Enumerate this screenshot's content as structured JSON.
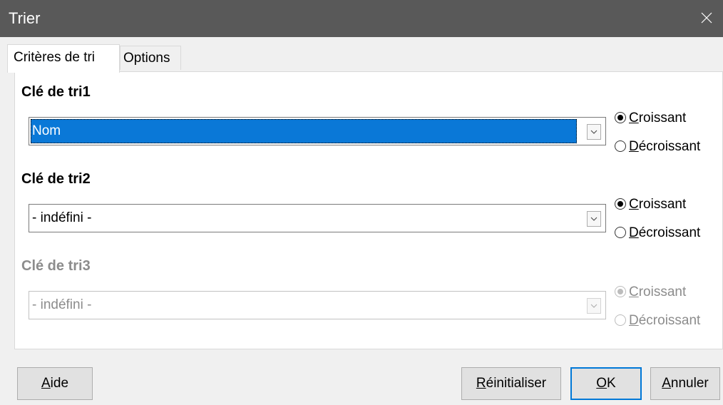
{
  "window": {
    "title": "Trier"
  },
  "tabs": [
    {
      "label": "Critères de tri",
      "active": true
    },
    {
      "label": "Options",
      "active": false
    }
  ],
  "keys": [
    {
      "label": "Clé de tri1",
      "value": "Nom",
      "selected": true,
      "enabled": true,
      "ascending_rest": "roissant",
      "ascending_key": "C",
      "descending_key": "D",
      "descending_rest": "écroissant",
      "order": "ascending"
    },
    {
      "label": "Clé de tri2",
      "value": "- indéfini -",
      "selected": false,
      "enabled": true,
      "ascending_rest": "roissant",
      "ascending_key": "C",
      "descending_key": "D",
      "descending_rest": "écroissant",
      "order": "ascending"
    },
    {
      "label": "Clé de tri3",
      "value": "- indéfini -",
      "selected": false,
      "enabled": false,
      "ascending_rest": "roissant",
      "ascending_key": "C",
      "descending_key": "D",
      "descending_rest": "écroissant",
      "order": "ascending"
    }
  ],
  "buttons": {
    "help_key": "A",
    "help_rest": "ide",
    "reset_key": "R",
    "reset_rest": "éinitialiser",
    "ok_key": "O",
    "ok_rest": "K",
    "cancel_key": "A",
    "cancel_rest": "nnuler"
  },
  "colors": {
    "title_bar": "#595959",
    "selection": "#0a78d7",
    "default_button_border": "#0078d7"
  }
}
